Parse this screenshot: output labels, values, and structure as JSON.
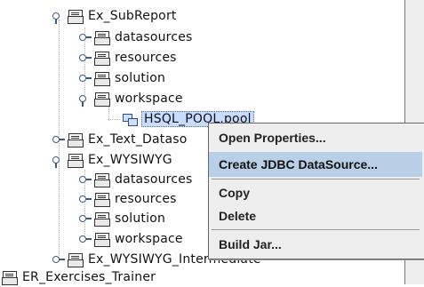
{
  "tree": {
    "ex_subreport": "Ex_SubReport",
    "datasources_1": "datasources",
    "resources_1": "resources",
    "solution_1": "solution",
    "workspace_1": "workspace",
    "hsql_pool": "HSQL_POOL.pool",
    "ex_text_datasource": "Ex_Text_Dataso",
    "ex_wysiwyg": "Ex_WYSIWYG",
    "datasources_2": "datasources",
    "resources_2": "resources",
    "solution_2": "solution",
    "workspace_2": "workspace",
    "ex_wysiwyg_intermediate": "Ex_WYSIWYG_Intermediate",
    "er_exercises_trainer": "ER_Exercises_Trainer"
  },
  "context_menu": {
    "open_properties": "Open Properties...",
    "create_jdbc": "Create JDBC DataSource...",
    "copy": "Copy",
    "delete": "Delete",
    "build_jar": "Build Jar..."
  },
  "colors": {
    "menu_hover": "#b8cfe5",
    "menu_bg": "#eeeeee",
    "selection": "#c8dcff"
  }
}
